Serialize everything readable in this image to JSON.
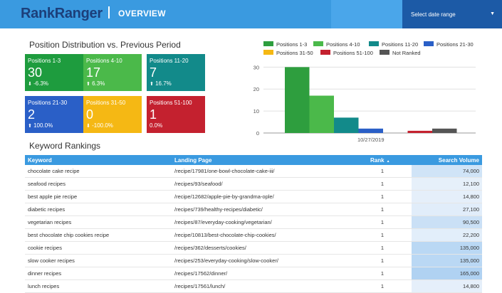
{
  "header": {
    "logo_part1": "Rank",
    "logo_part2": "Ranger",
    "title": "OVERVIEW",
    "date_range_placeholder": "Select date range",
    "caret_icon": "caret-down-icon"
  },
  "distribution": {
    "title": "Position Distribution vs. Previous Period",
    "tiles": [
      {
        "label": "Positions 1-3",
        "value": "30",
        "change": "-6.3%",
        "direction": "down",
        "color": "#1e9c3e"
      },
      {
        "label": "Positions 4-10",
        "value": "17",
        "change": "6.3%",
        "direction": "up",
        "color": "#4bb94a"
      },
      {
        "label": "Positions 11-20",
        "value": "7",
        "change": "16.7%",
        "direction": "up",
        "color": "#128a8a"
      },
      {
        "label": "Positions 21-30",
        "value": "2",
        "change": "100.0%",
        "direction": "up",
        "color": "#2a5fc7"
      },
      {
        "label": "Positions 31-50",
        "value": "0",
        "change": "-100.0%",
        "direction": "down",
        "color": "#f5b814"
      },
      {
        "label": "Positions 51-100",
        "value": "1",
        "change": "0.0%",
        "direction": "none",
        "color": "#c4212f"
      }
    ]
  },
  "chart_data": {
    "type": "bar",
    "categories": [
      "10/27/2019"
    ],
    "series": [
      {
        "name": "Positions 1-3",
        "values": [
          30
        ],
        "color": "#2e9e3e"
      },
      {
        "name": "Positions 4-10",
        "values": [
          17
        ],
        "color": "#4bb94a"
      },
      {
        "name": "Positions 11-20",
        "values": [
          7
        ],
        "color": "#128a8a"
      },
      {
        "name": "Positions 21-30",
        "values": [
          2
        ],
        "color": "#2a5fc7"
      },
      {
        "name": "Positions 31-50",
        "values": [
          0
        ],
        "color": "#f5b814"
      },
      {
        "name": "Positions 51-100",
        "values": [
          1
        ],
        "color": "#c4212f"
      },
      {
        "name": "Not Ranked",
        "values": [
          2
        ],
        "color": "#555555"
      }
    ],
    "yticks": [
      0,
      10,
      20,
      30
    ],
    "ylim": [
      0,
      34
    ],
    "legend": "top",
    "grid": true
  },
  "keywords": {
    "title": "Keyword Rankings",
    "columns": {
      "keyword": "Keyword",
      "landing": "Landing Page",
      "rank": "Rank",
      "volume": "Search Volume"
    },
    "sort_icon": "sort-up-icon",
    "rows": [
      {
        "keyword": "chocolate cake recipe",
        "landing": "/recipe/17981/one-bowl-chocolate-cake-iii/",
        "rank": "1",
        "volume": "74,000",
        "volume_share": 0.45
      },
      {
        "keyword": "seafood recipes",
        "landing": "/recipes/93/seafood/",
        "rank": "1",
        "volume": "12,100",
        "volume_share": 0.07
      },
      {
        "keyword": "best apple pie recipe",
        "landing": "/recipe/12682/apple-pie-by-grandma-ople/",
        "rank": "1",
        "volume": "14,800",
        "volume_share": 0.09
      },
      {
        "keyword": "diabetic recipes",
        "landing": "/recipes/739/healthy-recipes/diabetic/",
        "rank": "1",
        "volume": "27,100",
        "volume_share": 0.16
      },
      {
        "keyword": "vegetarian recipes",
        "landing": "/recipes/87/everyday-cooking/vegetarian/",
        "rank": "1",
        "volume": "90,500",
        "volume_share": 0.55
      },
      {
        "keyword": "best chocolate chip cookies recipe",
        "landing": "/recipe/10813/best-chocolate-chip-cookies/",
        "rank": "1",
        "volume": "22,200",
        "volume_share": 0.13
      },
      {
        "keyword": "cookie recipes",
        "landing": "/recipes/362/desserts/cookies/",
        "rank": "1",
        "volume": "135,000",
        "volume_share": 0.82
      },
      {
        "keyword": "slow cooker recipes",
        "landing": "/recipes/253/everyday-cooking/slow-cooker/",
        "rank": "1",
        "volume": "135,000",
        "volume_share": 0.82
      },
      {
        "keyword": "dinner recipes",
        "landing": "/recipes/17562/dinner/",
        "rank": "1",
        "volume": "165,000",
        "volume_share": 1.0
      },
      {
        "keyword": "lunch recipes",
        "landing": "/recipes/17561/lunch/",
        "rank": "1",
        "volume": "14,800",
        "volume_share": 0.09
      }
    ]
  }
}
